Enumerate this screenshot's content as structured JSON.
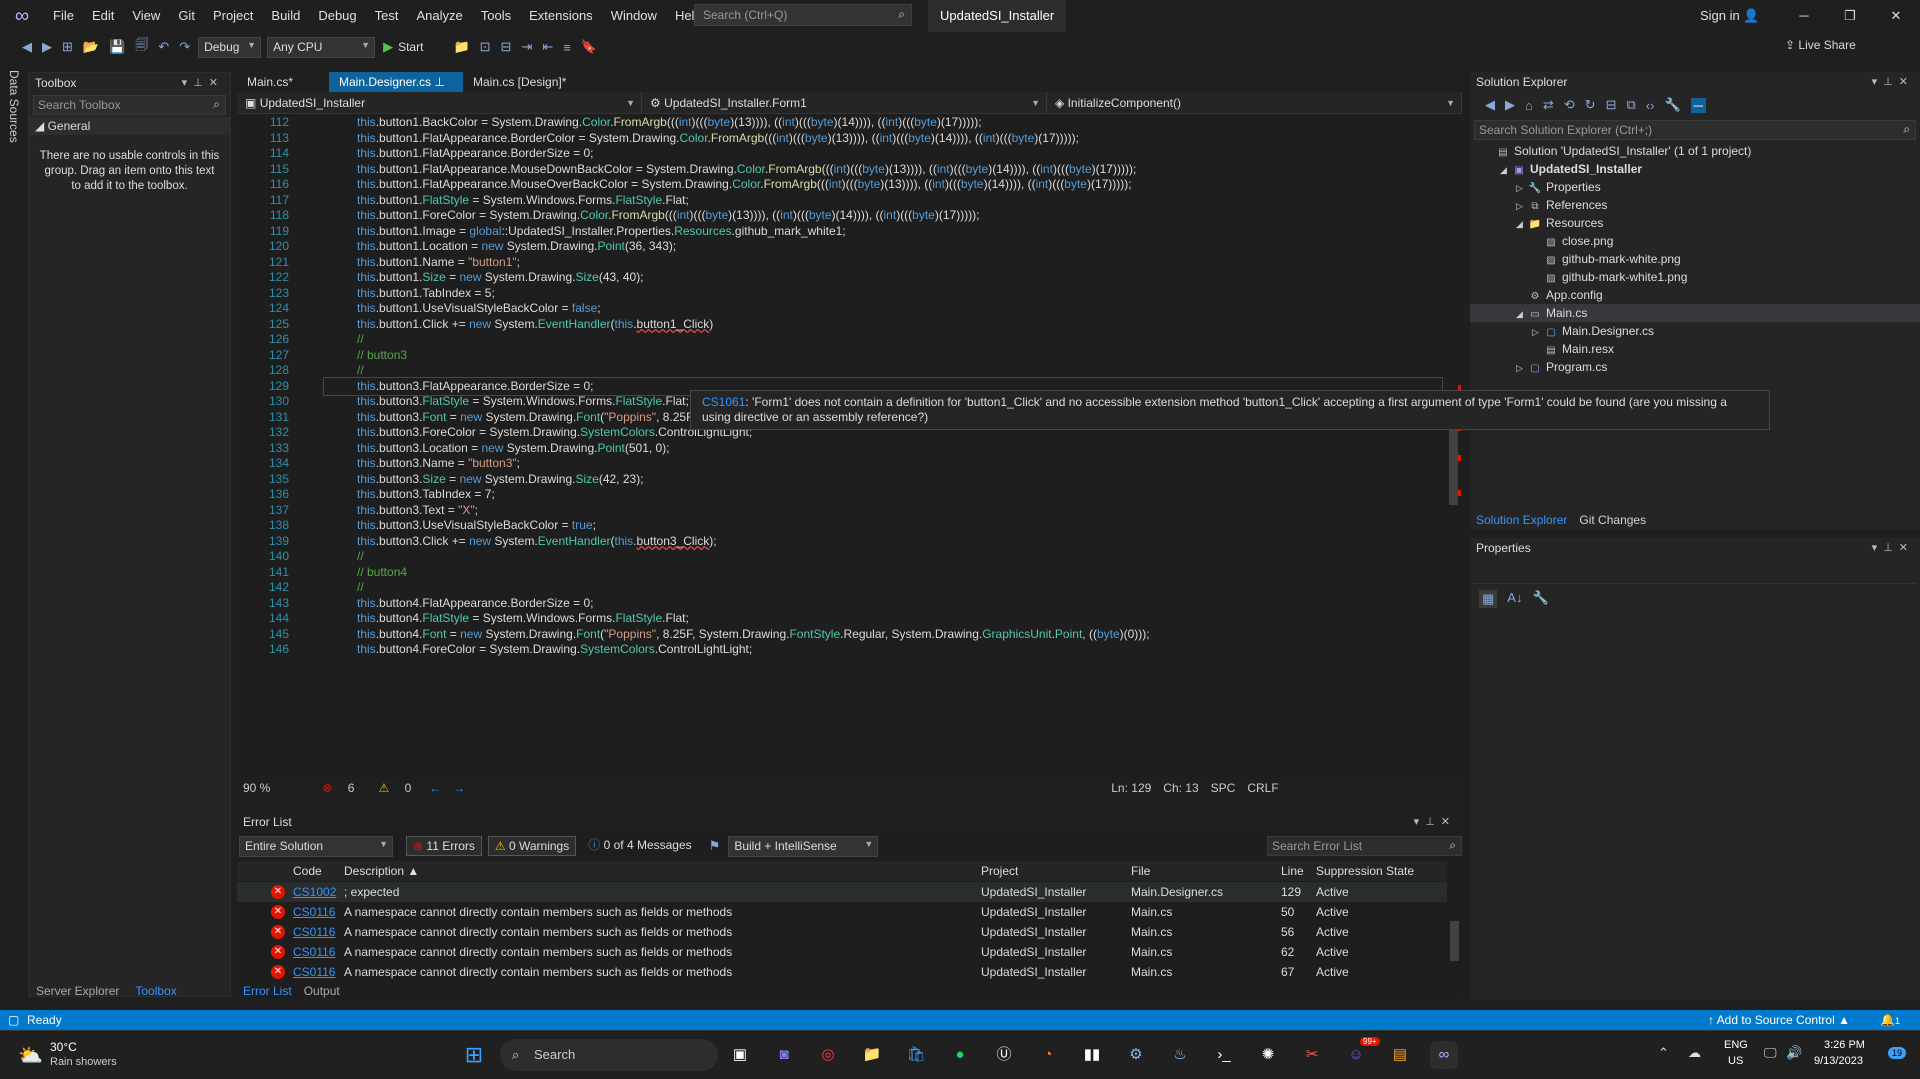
{
  "menubar": {
    "items": [
      "File",
      "Edit",
      "View",
      "Git",
      "Project",
      "Build",
      "Debug",
      "Test",
      "Analyze",
      "Tools",
      "Extensions",
      "Window",
      "Help"
    ],
    "search_placeholder": "Search (Ctrl+Q)",
    "solution_title": "UpdatedSI_Installer",
    "signin": "Sign in"
  },
  "toolbar": {
    "config": "Debug",
    "platform": "Any CPU",
    "start": "Start",
    "live_share": "Live Share"
  },
  "left_strip": {
    "label": "Data Sources"
  },
  "toolbox": {
    "title": "Toolbox",
    "search_placeholder": "Search Toolbox",
    "group": "General",
    "empty_text": "There are no usable controls in this group. Drag an item onto this text to add it to the toolbox.",
    "bottom_tabs": [
      "Server Explorer",
      "Toolbox"
    ]
  },
  "editor": {
    "tabs": [
      {
        "label": "Main.cs*"
      },
      {
        "label": "Main.Designer.cs"
      },
      {
        "label": "Main.cs [Design]*"
      }
    ],
    "nav": [
      "UpdatedSI_Installer",
      "UpdatedSI_Installer.Form1",
      "InitializeComponent()"
    ],
    "lines": [
      {
        "n": "112",
        "t": "this.button1.BackColor = System.Drawing.Color.FromArgb(((int)(((byte)(13)))), ((int)(((byte)(14)))), ((int)(((byte)(17)))));"
      },
      {
        "n": "113",
        "t": "this.button1.FlatAppearance.BorderColor = System.Drawing.Color.FromArgb(((int)(((byte)(13)))), ((int)(((byte)(14)))), ((int)(((byte)(17)))));"
      },
      {
        "n": "114",
        "t": "this.button1.FlatAppearance.BorderSize = 0;"
      },
      {
        "n": "115",
        "t": "this.button1.FlatAppearance.MouseDownBackColor = System.Drawing.Color.FromArgb(((int)(((byte)(13)))), ((int)(((byte)(14)))), ((int)(((byte)(17)))));"
      },
      {
        "n": "116",
        "t": "this.button1.FlatAppearance.MouseOverBackColor = System.Drawing.Color.FromArgb(((int)(((byte)(13)))), ((int)(((byte)(14)))), ((int)(((byte)(17)))));"
      },
      {
        "n": "117",
        "t": "this.button1.FlatStyle = System.Windows.Forms.FlatStyle.Flat;"
      },
      {
        "n": "118",
        "t": "this.button1.ForeColor = System.Drawing.Color.FromArgb(((int)(((byte)(13)))), ((int)(((byte)(14)))), ((int)(((byte)(17)))));"
      },
      {
        "n": "119",
        "t": "this.button1.Image = global::UpdatedSI_Installer.Properties.Resources.github_mark_white1;"
      },
      {
        "n": "120",
        "t": "this.button1.Location = new System.Drawing.Point(36, 343);"
      },
      {
        "n": "121",
        "t": "this.button1.Name = \"button1\";"
      },
      {
        "n": "122",
        "t": "this.button1.Size = new System.Drawing.Size(43, 40);"
      },
      {
        "n": "123",
        "t": "this.button1.TabIndex = 5;"
      },
      {
        "n": "124",
        "t": "this.button1.UseVisualStyleBackColor = false;"
      },
      {
        "n": "125",
        "t": "this.button1.Click += new System.EventHandler(this.button1_Click)"
      },
      {
        "n": "126",
        "t": "//"
      },
      {
        "n": "127",
        "t": "// button3"
      },
      {
        "n": "128",
        "t": "//"
      },
      {
        "n": "129",
        "t": "this.button3.FlatAppearance.BorderSize = 0;"
      },
      {
        "n": "130",
        "t": "this.button3.FlatStyle = System.Windows.Forms.FlatStyle.Flat;"
      },
      {
        "n": "131",
        "t": "this.button3.Font = new System.Drawing.Font(\"Poppins\", 8.25F, System.Drawing.FontStyle.Regular, System.Drawing.GraphicsUnit.Point, ((byte)(0)));"
      },
      {
        "n": "132",
        "t": "this.button3.ForeColor = System.Drawing.SystemColors.ControlLightLight;"
      },
      {
        "n": "133",
        "t": "this.button3.Location = new System.Drawing.Point(501, 0);"
      },
      {
        "n": "134",
        "t": "this.button3.Name = \"button3\";"
      },
      {
        "n": "135",
        "t": "this.button3.Size = new System.Drawing.Size(42, 23);"
      },
      {
        "n": "136",
        "t": "this.button3.TabIndex = 7;"
      },
      {
        "n": "137",
        "t": "this.button3.Text = \"X\";"
      },
      {
        "n": "138",
        "t": "this.button3.UseVisualStyleBackColor = true;"
      },
      {
        "n": "139",
        "t": "this.button3.Click += new System.EventHandler(this.button3_Click);"
      },
      {
        "n": "140",
        "t": "//"
      },
      {
        "n": "141",
        "t": "// button4"
      },
      {
        "n": "142",
        "t": "//"
      },
      {
        "n": "143",
        "t": "this.button4.FlatAppearance.BorderSize = 0;"
      },
      {
        "n": "144",
        "t": "this.button4.FlatStyle = System.Windows.Forms.FlatStyle.Flat;"
      },
      {
        "n": "145",
        "t": "this.button4.Font = new System.Drawing.Font(\"Poppins\", 8.25F, System.Drawing.FontStyle.Regular, System.Drawing.GraphicsUnit.Point, ((byte)(0)));"
      },
      {
        "n": "146",
        "t": "this.button4.ForeColor = System.Drawing.SystemColors.ControlLightLight;"
      }
    ],
    "tooltip": {
      "code": "CS1061",
      "text": ": 'Form1' does not contain a definition for 'button1_Click' and no accessible extension method 'button1_Click' accepting a first argument of type 'Form1' could be found (are you missing a using directive or an assembly reference?)"
    },
    "status": {
      "zoom": "90 %",
      "errors": "6",
      "warnings": "0",
      "ln": "Ln: 129",
      "ch": "Ch: 13",
      "spc": "SPC",
      "eol": "CRLF"
    }
  },
  "error_list": {
    "title": "Error List",
    "scope": "Entire Solution",
    "errors_btn": "11 Errors",
    "warnings_btn": "0 Warnings",
    "messages_btn": "0 of 4 Messages",
    "source": "Build + IntelliSense",
    "search_placeholder": "Search Error List",
    "columns": [
      "Code",
      "Description",
      "Project",
      "File",
      "Line",
      "Suppression State"
    ],
    "rows": [
      {
        "code": "CS1002",
        "desc": "; expected",
        "project": "UpdatedSI_Installer",
        "file": "Main.Designer.cs",
        "line": "129",
        "state": "Active"
      },
      {
        "code": "CS0116",
        "desc": "A namespace cannot directly contain members such as fields or methods",
        "project": "UpdatedSI_Installer",
        "file": "Main.cs",
        "line": "50",
        "state": "Active"
      },
      {
        "code": "CS0116",
        "desc": "A namespace cannot directly contain members such as fields or methods",
        "project": "UpdatedSI_Installer",
        "file": "Main.cs",
        "line": "56",
        "state": "Active"
      },
      {
        "code": "CS0116",
        "desc": "A namespace cannot directly contain members such as fields or methods",
        "project": "UpdatedSI_Installer",
        "file": "Main.cs",
        "line": "62",
        "state": "Active"
      },
      {
        "code": "CS0116",
        "desc": "A namespace cannot directly contain members such as fields or methods",
        "project": "UpdatedSI_Installer",
        "file": "Main.cs",
        "line": "67",
        "state": "Active"
      }
    ],
    "bottom_tabs": [
      "Error List",
      "Output"
    ]
  },
  "solution_explorer": {
    "title": "Solution Explorer",
    "search_placeholder": "Search Solution Explorer (Ctrl+;)",
    "tree": [
      {
        "label": "Solution 'UpdatedSI_Installer' (1 of 1 project)",
        "level": 0,
        "tw": "",
        "icon": "solution-icon"
      },
      {
        "label": "UpdatedSI_Installer",
        "level": 1,
        "tw": "◢",
        "icon": "csharp-project-icon",
        "bold": true
      },
      {
        "label": "Properties",
        "level": 2,
        "tw": "▷",
        "icon": "wrench-icon"
      },
      {
        "label": "References",
        "level": 2,
        "tw": "▷",
        "icon": "references-icon"
      },
      {
        "label": "Resources",
        "level": 2,
        "tw": "◢",
        "icon": "folder-icon"
      },
      {
        "label": "close.png",
        "level": 3,
        "tw": "",
        "icon": "image-file-icon"
      },
      {
        "label": "github-mark-white.png",
        "level": 3,
        "tw": "",
        "icon": "image-file-icon"
      },
      {
        "label": "github-mark-white1.png",
        "level": 3,
        "tw": "",
        "icon": "image-file-icon"
      },
      {
        "label": "App.config",
        "level": 2,
        "tw": "",
        "icon": "config-file-icon"
      },
      {
        "label": "Main.cs",
        "level": 2,
        "tw": "◢",
        "icon": "form-icon",
        "sel": true
      },
      {
        "label": "Main.Designer.cs",
        "level": 3,
        "tw": "▷",
        "icon": "cs-file-icon"
      },
      {
        "label": "Main.resx",
        "level": 3,
        "tw": "",
        "icon": "resx-file-icon"
      },
      {
        "label": "Program.cs",
        "level": 2,
        "tw": "▷",
        "icon": "cs-file-icon"
      }
    ],
    "tabs": [
      "Solution Explorer",
      "Git Changes"
    ]
  },
  "properties": {
    "title": "Properties"
  },
  "statusbar": {
    "ready": "Ready",
    "source_control": "Add to Source Control",
    "notif": "1"
  },
  "taskbar": {
    "weather_temp": "30°C",
    "weather_desc": "Rain showers",
    "search": "Search",
    "lang1": "ENG",
    "lang2": "US",
    "time": "3:26 PM",
    "date": "9/13/2023",
    "badge": "19",
    "discord_badge": "99+"
  },
  "colors": {
    "accent": "#007acc",
    "error": "#e51400",
    "active_tab": "#0e639c"
  }
}
